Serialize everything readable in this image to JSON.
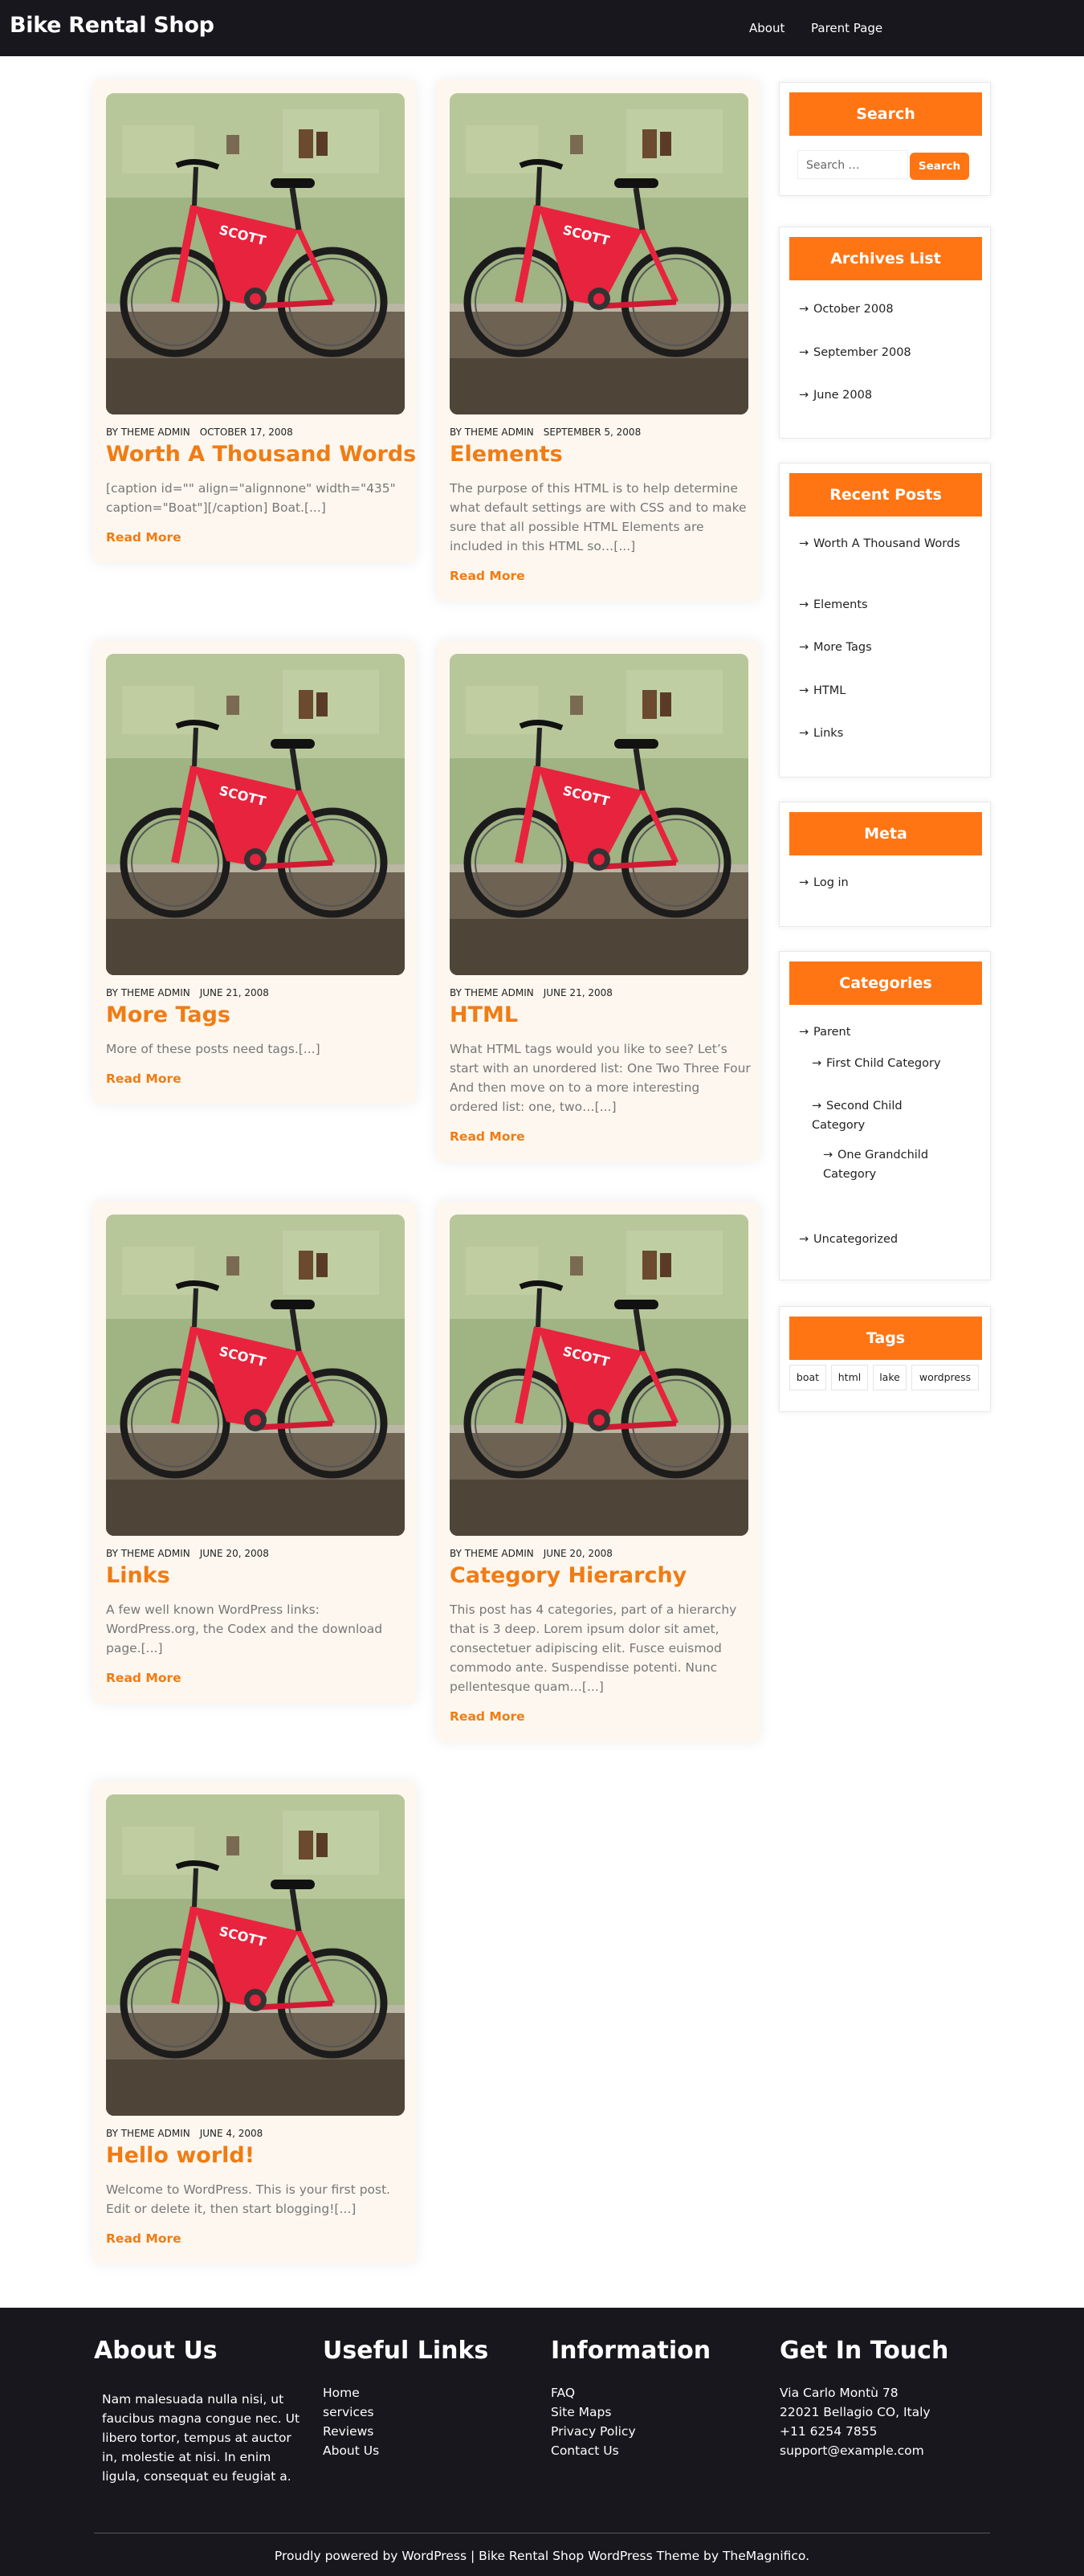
{
  "site": {
    "title": "Bike Rental Shop"
  },
  "nav": {
    "about": "About",
    "parent_page": "Parent Page"
  },
  "posts": [
    {
      "author": "BY THEME ADMIN",
      "date": "OCTOBER 17, 2008",
      "title": "Worth A Thousand Words",
      "excerpt": "[caption id=\"\" align=\"alignnone\" width=\"435\" caption=\"Boat\"][/caption] Boat.[...]",
      "read_more": "Read More"
    },
    {
      "author": "BY THEME ADMIN",
      "date": "SEPTEMBER 5, 2008",
      "title": "Elements",
      "excerpt": "The purpose of this HTML is to help determine what default settings are with CSS and to make sure that all possible HTML Elements are included in this HTML so…[...]",
      "read_more": "Read More"
    },
    {
      "author": "BY THEME ADMIN",
      "date": "JUNE 21, 2008",
      "title": "More Tags",
      "excerpt": "More of these posts need tags.[...]",
      "read_more": "Read More"
    },
    {
      "author": "BY THEME ADMIN",
      "date": "JUNE 21, 2008",
      "title": "HTML",
      "excerpt": "What HTML tags would you like to see? Let’s start with an unordered list: One Two Three Four And then move on to a more interesting ordered list: one, two…[...]",
      "read_more": "Read More"
    },
    {
      "author": "BY THEME ADMIN",
      "date": "JUNE 20, 2008",
      "title": "Links",
      "excerpt": "A few well known WordPress links: WordPress.org, the Codex and the download page.[...]",
      "read_more": "Read More"
    },
    {
      "author": "BY THEME ADMIN",
      "date": "JUNE 20, 2008",
      "title": "Category Hierarchy",
      "excerpt": "This post has 4 categories, part of a hierarchy that is 3 deep. Lorem ipsum dolor sit amet, consectetuer adipiscing elit. Fusce euismod commodo ante. Suspendisse potenti. Nunc pellentesque quam…[...]",
      "read_more": "Read More"
    },
    {
      "author": "BY THEME ADMIN",
      "date": "JUNE 4, 2008",
      "title": "Hello world!",
      "excerpt": "Welcome to WordPress. This is your first post. Edit or delete it, then start blogging![...]",
      "read_more": "Read More"
    }
  ],
  "sidebar": {
    "search": {
      "title": "Search",
      "placeholder": "Search …",
      "button": "Search"
    },
    "archives": {
      "title": "Archives List",
      "items": [
        "October 2008",
        "September 2008",
        "June 2008"
      ]
    },
    "recent": {
      "title": "Recent Posts",
      "items": [
        "Worth A Thousand Words",
        "Elements",
        "More Tags",
        "HTML",
        "Links"
      ]
    },
    "meta": {
      "title": "Meta",
      "items": [
        "Log in"
      ]
    },
    "categories": {
      "title": "Categories",
      "items": [
        "Parent",
        "First Child Category",
        "Second Child Category",
        "One Grandchild Category",
        "Uncategorized"
      ]
    },
    "tags": {
      "title": "Tags",
      "items": [
        "boat",
        "html",
        "lake",
        "wordpress"
      ]
    }
  },
  "footer": {
    "about": {
      "title": "About Us",
      "text": "Nam malesuada nulla nisi, ut faucibus magna congue nec. Ut libero tortor, tempus at auctor in, molestie at nisi. In enim ligula, consequat eu feugiat a."
    },
    "useful": {
      "title": "Useful Links",
      "items": [
        "Home",
        "services",
        "Reviews",
        "About Us"
      ]
    },
    "info": {
      "title": "Information",
      "items": [
        "FAQ",
        "Site Maps",
        "Privacy Policy",
        "Contact Us"
      ]
    },
    "contact": {
      "title": "Get In Touch",
      "items": [
        "Via Carlo Montù 78",
        "22021 Bellagio CO, Italy",
        "+11 6254 7855",
        "support@example.com"
      ]
    },
    "copyright": "Proudly powered by WordPress | Bike Rental Shop WordPress Theme by TheMagnifico."
  },
  "colors": {
    "accent": "#ff7514",
    "title_orange": "#f07c14",
    "dark": "#17171d",
    "card_bg": "#fdf7ef"
  }
}
